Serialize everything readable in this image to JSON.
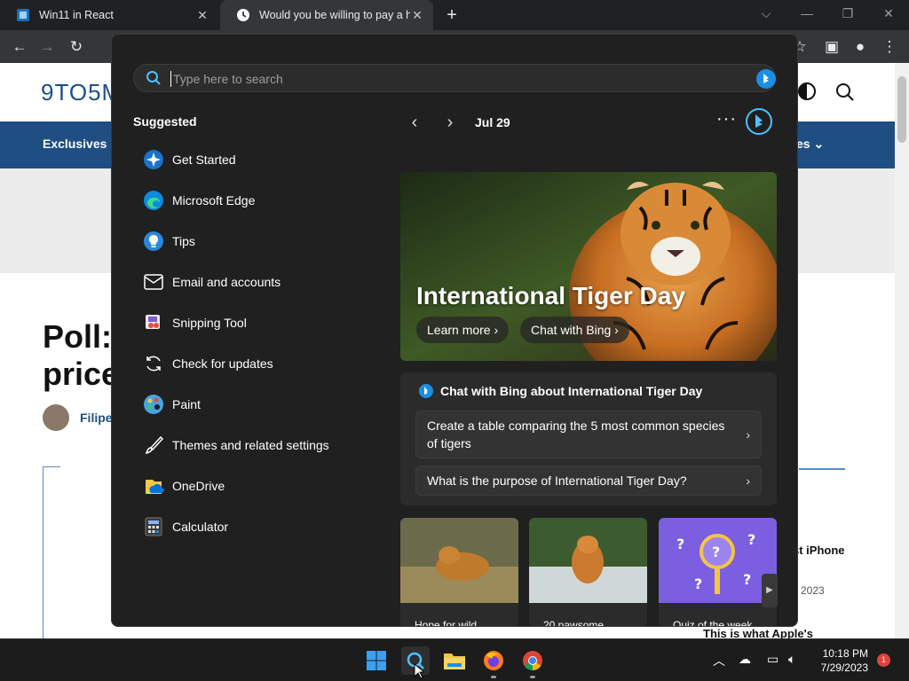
{
  "browser": {
    "tabs": [
      {
        "title": "Win11 in React",
        "close": "✕"
      },
      {
        "title": "Would you be willing to pay a hig",
        "close": "✕"
      }
    ],
    "new_tab": "+",
    "window_controls": {
      "dropdown": "⌵",
      "minimize": "—",
      "restore": "❐",
      "close": "✕"
    }
  },
  "webpage": {
    "logo": "9TO5M",
    "nav_first": "Exclusives",
    "nav_last": "es ⌄",
    "title": "Poll: price",
    "author": "Filipe",
    "sidebar_text": "st iPhone",
    "sidebar_date": "2023",
    "bottom_text": "This is what Apple's"
  },
  "start": {
    "search_placeholder": "Type here to search",
    "suggested_title": "Suggested",
    "suggested": [
      {
        "label": "Get Started",
        "icon": "get-started-icon"
      },
      {
        "label": "Microsoft Edge",
        "icon": "edge-icon"
      },
      {
        "label": "Tips",
        "icon": "tips-icon"
      },
      {
        "label": "Email and accounts",
        "icon": "mail-icon"
      },
      {
        "label": "Snipping Tool",
        "icon": "snipping-tool-icon"
      },
      {
        "label": "Check for updates",
        "icon": "refresh-icon"
      },
      {
        "label": "Paint",
        "icon": "paint-icon"
      },
      {
        "label": "Themes and related settings",
        "icon": "brush-icon"
      },
      {
        "label": "OneDrive",
        "icon": "onedrive-icon"
      },
      {
        "label": "Calculator",
        "icon": "calculator-icon"
      }
    ],
    "date": "Jul 29",
    "more": "···",
    "hero": {
      "title": "International Tiger Day",
      "learn_more": "Learn more",
      "chat_with_bing": "Chat with Bing"
    },
    "bing_card": {
      "title": "Chat with Bing about International Tiger Day",
      "prompts": [
        "Create a table comparing the 5 most common species of tigers",
        "What is the purpose of International Tiger Day?"
      ]
    },
    "thumbnails": [
      {
        "caption": "Hope for wild"
      },
      {
        "caption": "20 pawsome"
      },
      {
        "caption": "Quiz of the week"
      }
    ]
  },
  "taskbar": {
    "time": "10:18 PM",
    "date": "7/29/2023",
    "notifications": "1"
  },
  "colors": {
    "accent": "#0078d4",
    "flyout_bg": "#202020",
    "card_bg": "#2b2b2b",
    "nav_blue": "#1f4e82"
  }
}
